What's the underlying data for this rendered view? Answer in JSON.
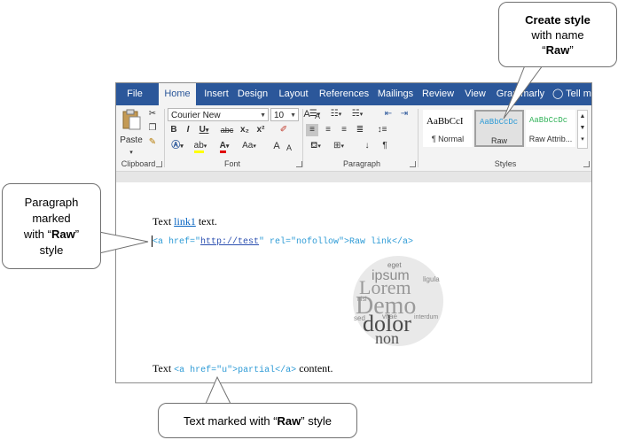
{
  "tabs": [
    "File",
    "Home",
    "Insert",
    "Design",
    "Layout",
    "References",
    "Mailings",
    "Review",
    "View",
    "Grammarly",
    "Tell me"
  ],
  "active_tab": "Home",
  "ribbon": {
    "clipboard_label": "Clipboard",
    "paste_label": "Paste",
    "font_label": "Font",
    "font_name": "Courier New",
    "font_size": "10",
    "bold": "B",
    "italic": "I",
    "underline": "U",
    "strike": "abc",
    "subscript": "x₂",
    "superscript": "x²",
    "change_case": "Aa",
    "grow": "A",
    "shrink": "A",
    "paragraph_label": "Paragraph",
    "pilcrow": "¶",
    "styles_label": "Styles",
    "styles": [
      {
        "sample": "AaBbCcI",
        "name": "¶ Normal"
      },
      {
        "sample": "AaBbCcDc",
        "name": "Raw"
      },
      {
        "sample": "AaBbCcDc",
        "name": "Raw Attrib..."
      }
    ]
  },
  "document": {
    "p1_before": "Text ",
    "p1_link": "link1",
    "p1_after": " text.",
    "p2_a": "<a href=\"",
    "p2_url": "http://test",
    "p2_b": "\" rel=\"nofollow\">Raw link</a>",
    "p3_before": "Text ",
    "p3_code": "<a href=\"u\">partial</a>",
    "p3_after": " content."
  },
  "wordcloud": [
    "eget",
    "ipsum",
    "Lorem",
    "Demo",
    "dolor",
    "non",
    "sed",
    "vitae",
    "ligula",
    "nisl",
    "interdum"
  ],
  "callouts": {
    "create_style_bold": "Create style",
    "create_style_line2": "with name",
    "create_style_name_prefix": "“",
    "create_style_name": "Raw",
    "create_style_name_suffix": "”",
    "paragraph_line1": "Paragraph",
    "paragraph_line2": "marked",
    "paragraph_line3_prefix": "with “",
    "paragraph_line3_name": "Raw",
    "paragraph_line3_suffix": "”",
    "paragraph_line4": "style",
    "text_prefix": "Text marked with “",
    "text_name": "Raw",
    "text_suffix": "” style"
  }
}
